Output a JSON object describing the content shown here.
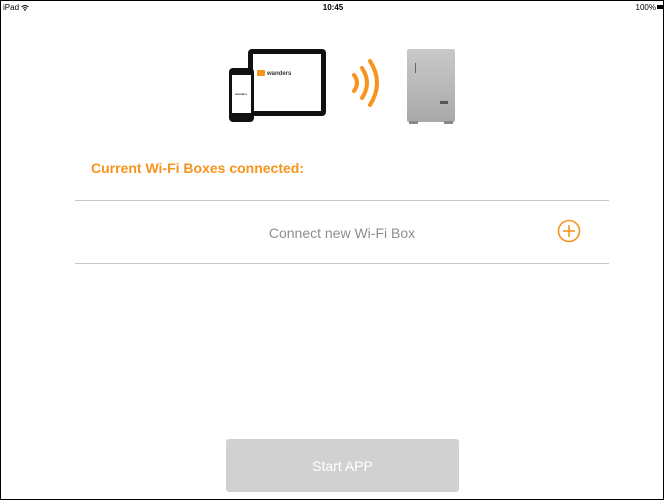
{
  "status_bar": {
    "device": "iPad",
    "wifi_icon": "wifi-icon",
    "time": "10:45",
    "battery": "100%"
  },
  "illustration": {
    "tablet_brand": "wanders",
    "accent_color": "#f7941d"
  },
  "section": {
    "title": "Current Wi-Fi Boxes connected:"
  },
  "connect": {
    "label": "Connect new Wi-Fi Box",
    "icon": "plus-circle-icon"
  },
  "start_button": {
    "label": "Start APP",
    "background": "#d1d1d1"
  }
}
